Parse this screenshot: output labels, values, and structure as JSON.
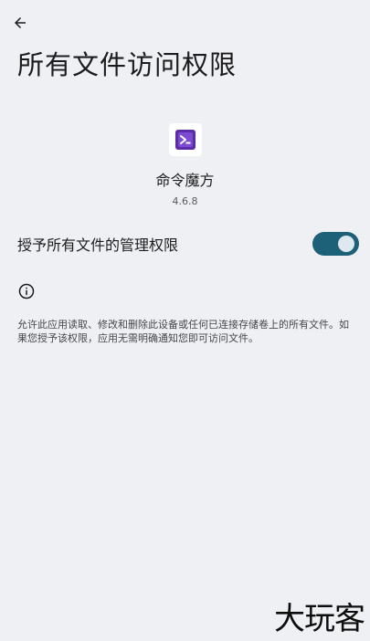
{
  "header": {
    "title": "所有文件访问权限"
  },
  "app": {
    "name": "命令魔方",
    "version": "4.6.8"
  },
  "permission": {
    "label": "授予所有文件的管理权限",
    "enabled": true
  },
  "info": {
    "description": "允许此应用读取、修改和删除此设备或任何已连接存储卷上的所有文件。如果您授予该权限，应用无需明确通知您即可访问文件。"
  },
  "watermark": {
    "text": "大玩客"
  },
  "colors": {
    "background": "#eff0f3",
    "toggle_track": "#1d6178",
    "app_icon_accent": "#5b2ca6"
  },
  "icons": {
    "back": "arrow-back-icon",
    "info": "info-icon",
    "app": "app-icon"
  }
}
